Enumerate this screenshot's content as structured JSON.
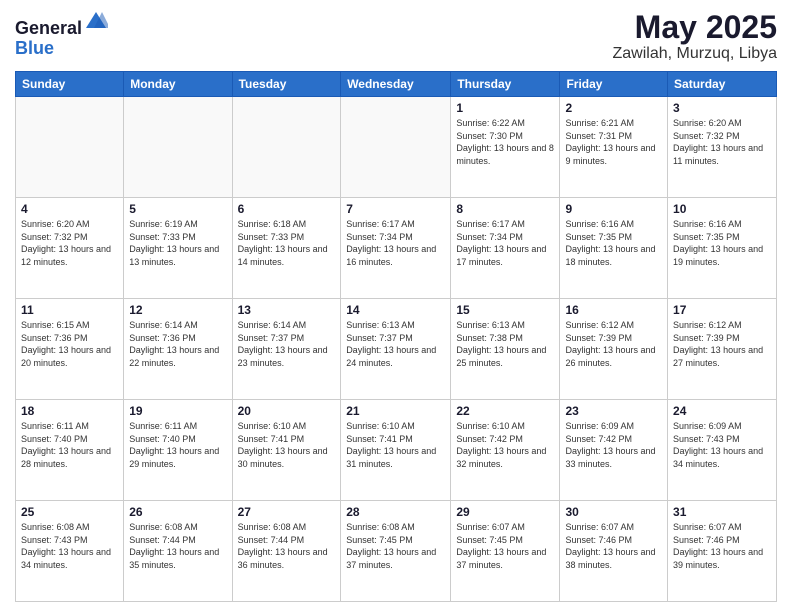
{
  "header": {
    "logo_general": "General",
    "logo_blue": "Blue",
    "month": "May 2025",
    "location": "Zawilah, Murzuq, Libya"
  },
  "weekdays": [
    "Sunday",
    "Monday",
    "Tuesday",
    "Wednesday",
    "Thursday",
    "Friday",
    "Saturday"
  ],
  "weeks": [
    [
      {
        "day": "",
        "sunrise": "",
        "sunset": "",
        "daylight": ""
      },
      {
        "day": "",
        "sunrise": "",
        "sunset": "",
        "daylight": ""
      },
      {
        "day": "",
        "sunrise": "",
        "sunset": "",
        "daylight": ""
      },
      {
        "day": "",
        "sunrise": "",
        "sunset": "",
        "daylight": ""
      },
      {
        "day": "1",
        "sunrise": "6:22 AM",
        "sunset": "7:30 PM",
        "daylight": "13 hours and 8 minutes."
      },
      {
        "day": "2",
        "sunrise": "6:21 AM",
        "sunset": "7:31 PM",
        "daylight": "13 hours and 9 minutes."
      },
      {
        "day": "3",
        "sunrise": "6:20 AM",
        "sunset": "7:32 PM",
        "daylight": "13 hours and 11 minutes."
      }
    ],
    [
      {
        "day": "4",
        "sunrise": "6:20 AM",
        "sunset": "7:32 PM",
        "daylight": "13 hours and 12 minutes."
      },
      {
        "day": "5",
        "sunrise": "6:19 AM",
        "sunset": "7:33 PM",
        "daylight": "13 hours and 13 minutes."
      },
      {
        "day": "6",
        "sunrise": "6:18 AM",
        "sunset": "7:33 PM",
        "daylight": "13 hours and 14 minutes."
      },
      {
        "day": "7",
        "sunrise": "6:17 AM",
        "sunset": "7:34 PM",
        "daylight": "13 hours and 16 minutes."
      },
      {
        "day": "8",
        "sunrise": "6:17 AM",
        "sunset": "7:34 PM",
        "daylight": "13 hours and 17 minutes."
      },
      {
        "day": "9",
        "sunrise": "6:16 AM",
        "sunset": "7:35 PM",
        "daylight": "13 hours and 18 minutes."
      },
      {
        "day": "10",
        "sunrise": "6:16 AM",
        "sunset": "7:35 PM",
        "daylight": "13 hours and 19 minutes."
      }
    ],
    [
      {
        "day": "11",
        "sunrise": "6:15 AM",
        "sunset": "7:36 PM",
        "daylight": "13 hours and 20 minutes."
      },
      {
        "day": "12",
        "sunrise": "6:14 AM",
        "sunset": "7:36 PM",
        "daylight": "13 hours and 22 minutes."
      },
      {
        "day": "13",
        "sunrise": "6:14 AM",
        "sunset": "7:37 PM",
        "daylight": "13 hours and 23 minutes."
      },
      {
        "day": "14",
        "sunrise": "6:13 AM",
        "sunset": "7:37 PM",
        "daylight": "13 hours and 24 minutes."
      },
      {
        "day": "15",
        "sunrise": "6:13 AM",
        "sunset": "7:38 PM",
        "daylight": "13 hours and 25 minutes."
      },
      {
        "day": "16",
        "sunrise": "6:12 AM",
        "sunset": "7:39 PM",
        "daylight": "13 hours and 26 minutes."
      },
      {
        "day": "17",
        "sunrise": "6:12 AM",
        "sunset": "7:39 PM",
        "daylight": "13 hours and 27 minutes."
      }
    ],
    [
      {
        "day": "18",
        "sunrise": "6:11 AM",
        "sunset": "7:40 PM",
        "daylight": "13 hours and 28 minutes."
      },
      {
        "day": "19",
        "sunrise": "6:11 AM",
        "sunset": "7:40 PM",
        "daylight": "13 hours and 29 minutes."
      },
      {
        "day": "20",
        "sunrise": "6:10 AM",
        "sunset": "7:41 PM",
        "daylight": "13 hours and 30 minutes."
      },
      {
        "day": "21",
        "sunrise": "6:10 AM",
        "sunset": "7:41 PM",
        "daylight": "13 hours and 31 minutes."
      },
      {
        "day": "22",
        "sunrise": "6:10 AM",
        "sunset": "7:42 PM",
        "daylight": "13 hours and 32 minutes."
      },
      {
        "day": "23",
        "sunrise": "6:09 AM",
        "sunset": "7:42 PM",
        "daylight": "13 hours and 33 minutes."
      },
      {
        "day": "24",
        "sunrise": "6:09 AM",
        "sunset": "7:43 PM",
        "daylight": "13 hours and 34 minutes."
      }
    ],
    [
      {
        "day": "25",
        "sunrise": "6:08 AM",
        "sunset": "7:43 PM",
        "daylight": "13 hours and 34 minutes."
      },
      {
        "day": "26",
        "sunrise": "6:08 AM",
        "sunset": "7:44 PM",
        "daylight": "13 hours and 35 minutes."
      },
      {
        "day": "27",
        "sunrise": "6:08 AM",
        "sunset": "7:44 PM",
        "daylight": "13 hours and 36 minutes."
      },
      {
        "day": "28",
        "sunrise": "6:08 AM",
        "sunset": "7:45 PM",
        "daylight": "13 hours and 37 minutes."
      },
      {
        "day": "29",
        "sunrise": "6:07 AM",
        "sunset": "7:45 PM",
        "daylight": "13 hours and 37 minutes."
      },
      {
        "day": "30",
        "sunrise": "6:07 AM",
        "sunset": "7:46 PM",
        "daylight": "13 hours and 38 minutes."
      },
      {
        "day": "31",
        "sunrise": "6:07 AM",
        "sunset": "7:46 PM",
        "daylight": "13 hours and 39 minutes."
      }
    ]
  ]
}
